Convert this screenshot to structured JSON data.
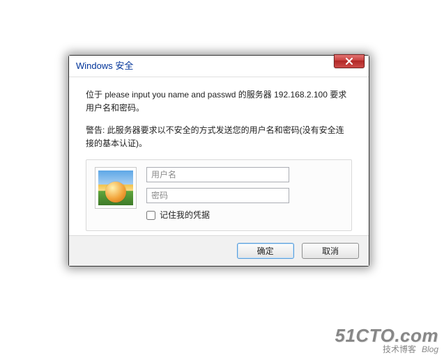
{
  "dialog": {
    "title": "Windows 安全",
    "message1": "位于 please input you name and passwd 的服务器 192.168.2.100 要求用户名和密码。",
    "message2": "警告: 此服务器要求以不安全的方式发送您的用户名和密码(没有安全连接的基本认证)。",
    "username_placeholder": "用户名",
    "password_placeholder": "密码",
    "remember_label": "记住我的凭据",
    "ok_label": "确定",
    "cancel_label": "取消"
  },
  "watermark": {
    "main": "51CTO.com",
    "sub": "技术博客",
    "blog": "Blog"
  }
}
